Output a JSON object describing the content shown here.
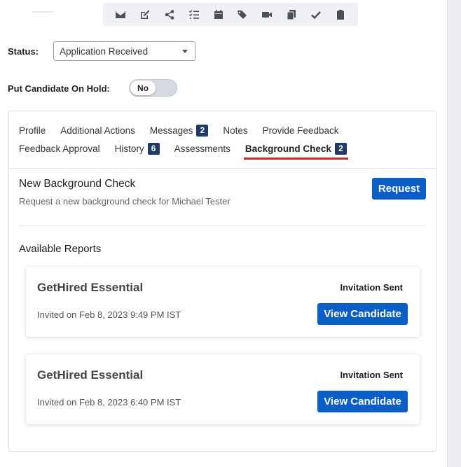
{
  "toolbar": {
    "icons": [
      "envelope-icon",
      "edit-icon",
      "share-icon",
      "checklist-icon",
      "calendar-icon",
      "tags-icon",
      "video-icon",
      "copy-icon",
      "check-icon",
      "clipboard-icon"
    ]
  },
  "status": {
    "label": "Status:",
    "value": "Application Received"
  },
  "hold": {
    "label": "Put Candidate On Hold:",
    "toggle_text": "No"
  },
  "tabs": {
    "row1": [
      {
        "label": "Profile"
      },
      {
        "label": "Additional Actions"
      },
      {
        "label": "Messages",
        "badge": "2"
      },
      {
        "label": "Notes"
      },
      {
        "label": "Provide Feedback"
      }
    ],
    "row2": [
      {
        "label": "Feedback Approval"
      },
      {
        "label": "History",
        "badge": "6"
      },
      {
        "label": "Assessments"
      },
      {
        "label": "Background Check",
        "badge": "2",
        "active": true
      }
    ]
  },
  "new_check": {
    "title": "New Background Check",
    "description": "Request a new background check for Michael Tester",
    "button": "Request"
  },
  "reports": {
    "title": "Available Reports",
    "items": [
      {
        "name": "GetHired Essential",
        "status": "Invitation Sent",
        "date": "Invited on Feb 8, 2023 9:49 PM IST",
        "button": "View Candidate"
      },
      {
        "name": "GetHired Essential",
        "status": "Invitation Sent",
        "date": "Invited on Feb 8, 2023 6:40 PM IST",
        "button": "View Candidate"
      }
    ]
  },
  "colors": {
    "primary_button": "#0a5ec7",
    "badge": "#1f3b63",
    "active_underline": "#c62828"
  }
}
